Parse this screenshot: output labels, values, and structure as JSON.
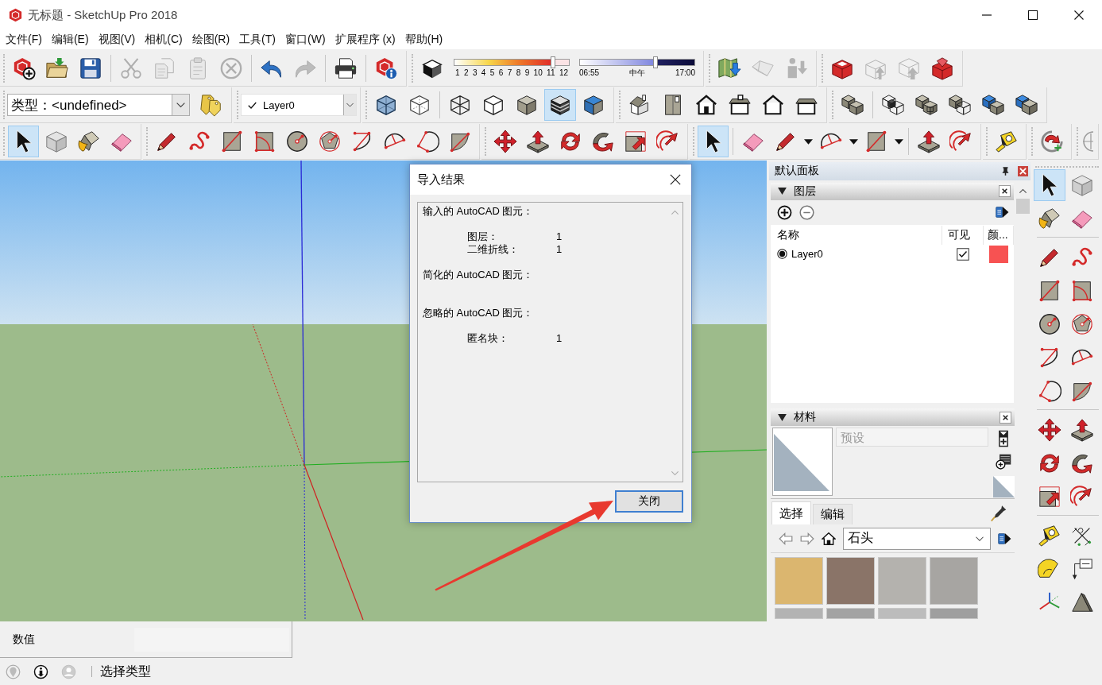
{
  "window": {
    "title": "无标题 - SketchUp Pro 2018"
  },
  "menu": [
    "文件(F)",
    "编辑(E)",
    "视图(V)",
    "相机(C)",
    "绘图(R)",
    "工具(T)",
    "窗口(W)",
    "扩展程序 (x)",
    "帮助(H)"
  ],
  "toolbar_row_1": {
    "buttons": [
      {
        "disabled": false
      },
      {
        "disabled": false
      },
      {
        "disabled": false
      },
      {
        "disabled": true
      },
      {
        "disabled": true
      },
      {
        "disabled": true
      },
      {
        "disabled": true
      },
      {
        "disabled": false
      },
      {
        "disabled": true
      },
      {
        "disabled": false
      },
      {
        "disabled": false
      },
      {
        "disabled": false
      },
      {
        "disabled": false
      },
      {
        "disabled": true
      },
      {
        "disabled": true
      },
      {
        "disabled": false
      },
      {
        "disabled": true
      },
      {
        "disabled": true
      },
      {
        "disabled": false
      }
    ],
    "shadow_date": {
      "ticks": [
        "1",
        "2",
        "3",
        "4",
        "5",
        "6",
        "7",
        "8",
        "9",
        "10",
        "11",
        "12"
      ],
      "level": 0.86
    },
    "shadow_time": {
      "start": "06:55",
      "middle": "中午",
      "end": "17:00",
      "level": 0.66
    }
  },
  "toolbar_row_2": {
    "type_box": {
      "value": "类型：<undefined>"
    },
    "layer_box": {
      "value": "Layer0",
      "checked": true
    },
    "buttons": [
      {
        "selected": false
      },
      {
        "selected": false
      },
      {
        "selected": false
      },
      {
        "selected": false
      },
      {
        "selected": false
      },
      {
        "selected": false
      },
      {
        "selected": true
      },
      {
        "selected": false
      },
      {
        "selected": false
      },
      {
        "selected": false
      },
      {
        "selected": false
      },
      {
        "selected": false
      },
      {
        "selected": false
      },
      {
        "selected": false
      },
      {
        "selected": false
      },
      {
        "selected": false
      },
      {
        "selected": false
      },
      {
        "selected": false
      },
      {
        "selected": false
      },
      {
        "selected": false
      }
    ]
  },
  "toolbar_row_3": {
    "buttons": [
      {
        "selected": true
      },
      {
        "selected": false
      },
      {
        "selected": false
      },
      {
        "selected": false
      },
      {
        "selected": false
      },
      {
        "selected": false
      },
      {
        "selected": false
      },
      {
        "selected": false
      },
      {
        "selected": false
      },
      {
        "selected": false
      },
      {
        "selected": false
      },
      {
        "selected": false
      },
      {
        "selected": false
      },
      {
        "selected": false
      },
      {
        "selected": false
      },
      {
        "selected": false
      },
      {
        "selected": false
      },
      {
        "selected": false
      },
      {
        "selected": false
      },
      {
        "selected": false
      },
      {
        "selected": true
      },
      {
        "selected": false
      },
      {
        "selected": false
      },
      {
        "selected": false
      },
      {
        "selected": false
      },
      {
        "selected": false
      },
      {
        "selected": false
      },
      {
        "selected": false
      },
      {
        "selected": false
      },
      {
        "selected": false
      }
    ]
  },
  "side_toolbar": {
    "buttons": [
      {
        "selected": true
      },
      {
        "selected": false
      },
      {
        "selected": false
      },
      {
        "selected": false
      },
      {
        "selected": false
      },
      {
        "selected": false
      },
      {
        "selected": false
      },
      {
        "selected": false
      },
      {
        "selected": false
      },
      {
        "selected": false
      },
      {
        "selected": false
      },
      {
        "selected": false
      },
      {
        "selected": false
      },
      {
        "selected": false
      },
      {
        "selected": false
      },
      {
        "selected": false
      },
      {
        "selected": false
      },
      {
        "selected": false
      },
      {
        "selected": false
      },
      {
        "selected": false
      },
      {
        "selected": false
      },
      {
        "selected": false
      },
      {
        "selected": false
      },
      {
        "selected": false
      },
      {
        "selected": false
      },
      {
        "selected": false
      }
    ]
  },
  "tray": {
    "title": "默认面板",
    "layers": {
      "title": "图层",
      "expanded": true,
      "columns": [
        "名称",
        "可见",
        "颜..."
      ],
      "rows": [
        {
          "name": "Layer0",
          "current": true,
          "visible": true,
          "color": "#f75252"
        }
      ]
    },
    "materials": {
      "title": "材料",
      "expanded": true,
      "name_field": {
        "placeholder": "预设"
      },
      "tabs": [
        {
          "label": "选择",
          "selected": true
        },
        {
          "label": "编辑",
          "selected": false
        }
      ],
      "collection": "石头",
      "swatches": [
        {
          "color": "#dbb66f"
        },
        {
          "color": "#8a7468"
        },
        {
          "color": "#b4b2ae"
        },
        {
          "color": "#a7a5a2"
        },
        {
          "color": "#b3b3b3"
        },
        {
          "color": "#a3a3a3"
        },
        {
          "color": "#bcbcbc"
        },
        {
          "color": "#9f9f9f"
        }
      ]
    }
  },
  "measurements": {
    "label": "数值"
  },
  "status_bar": {
    "text": "选择类型"
  },
  "dialog": {
    "title": "导入结果",
    "report": [
      {
        "kind": "heading",
        "text": "输入的 AutoCAD 图元："
      },
      {
        "kind": "item",
        "label": "图层：",
        "value": "1"
      },
      {
        "kind": "item",
        "label": "二维折线：",
        "value": "1"
      },
      {
        "kind": "heading",
        "text": "简化的 AutoCAD 图元："
      },
      {
        "kind": "heading",
        "text": "忽略的 AutoCAD 图元："
      },
      {
        "kind": "item",
        "label": "匿名块：",
        "value": "1"
      }
    ],
    "button": "关闭"
  }
}
